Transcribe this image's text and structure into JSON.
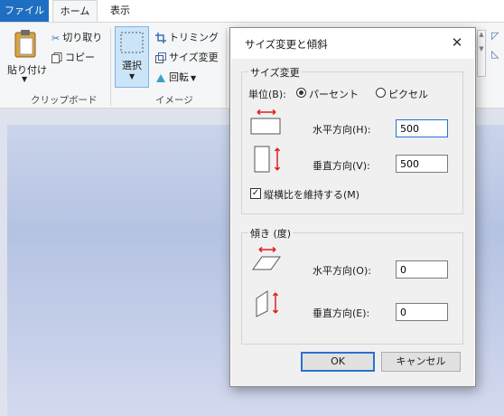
{
  "ribbon": {
    "tabs": [
      {
        "label": "ファイル"
      },
      {
        "label": "ホーム"
      },
      {
        "label": "表示"
      }
    ],
    "clipboard": {
      "paste_label": "貼り付け",
      "cut_label": "切り取り",
      "copy_label": "コピー",
      "group_label": "クリップボード"
    },
    "image": {
      "select_label": "選択",
      "crop_label": "トリミング",
      "resize_label": "サイズ変更",
      "rotate_label": "回転",
      "group_label": "イメージ"
    }
  },
  "dialog": {
    "title": "サイズ変更と傾斜",
    "close_glyph": "✕",
    "resize": {
      "group_title": "サイズ変更",
      "unit_label": "単位(B):",
      "percent_label": "パーセント",
      "pixel_label": "ピクセル",
      "unit_selected": "パーセント",
      "horizontal_label": "水平方向(H):",
      "horizontal_value": "500",
      "vertical_label": "垂直方向(V):",
      "vertical_value": "500",
      "keep_ratio_label": "縦横比を維持する(M)",
      "keep_ratio_checked": true
    },
    "skew": {
      "group_title": "傾き (度)",
      "horizontal_label": "水平方向(O):",
      "horizontal_value": "0",
      "vertical_label": "垂直方向(E):",
      "vertical_value": "0"
    },
    "ok_label": "OK",
    "cancel_label": "キャンセル"
  },
  "colors": {
    "file_tab": "#1e6fc1",
    "accent_red": "#e02020",
    "focus_blue": "#2a71d0",
    "canvas": "#c3cde8"
  }
}
